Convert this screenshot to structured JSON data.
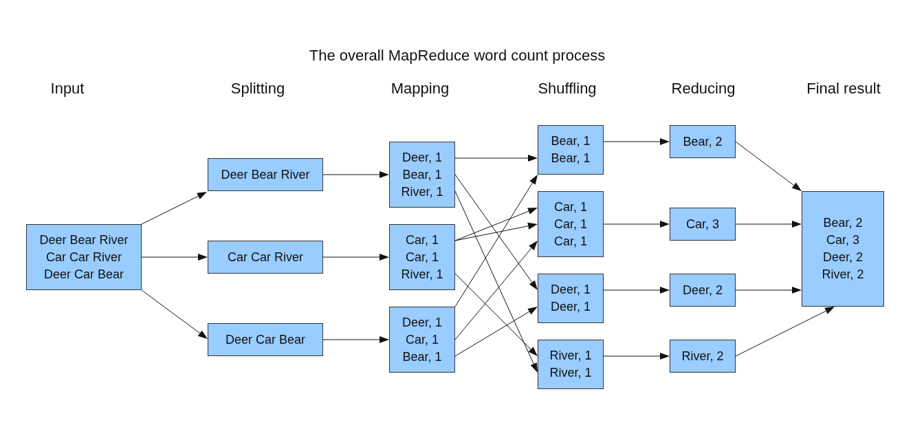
{
  "title": "The overall MapReduce word count process",
  "columns": [
    {
      "heading": "Input",
      "nodes": [
        {
          "lines": [
            "Deer Bear River",
            "Car Car River",
            "Deer Car Bear"
          ]
        }
      ]
    },
    {
      "heading": "Splitting",
      "nodes": [
        {
          "lines": [
            "Deer Bear River"
          ]
        },
        {
          "lines": [
            "Car Car River"
          ]
        },
        {
          "lines": [
            "Deer Car Bear"
          ]
        }
      ]
    },
    {
      "heading": "Mapping",
      "nodes": [
        {
          "lines": [
            "Deer, 1",
            "Bear, 1",
            "River, 1"
          ]
        },
        {
          "lines": [
            "Car, 1",
            "Car, 1",
            "River, 1"
          ]
        },
        {
          "lines": [
            "Deer, 1",
            "Car, 1",
            "Bear, 1"
          ]
        }
      ]
    },
    {
      "heading": "Shuffling",
      "nodes": [
        {
          "lines": [
            "Bear, 1",
            "Bear, 1"
          ]
        },
        {
          "lines": [
            "Car, 1",
            "Car, 1",
            "Car, 1"
          ]
        },
        {
          "lines": [
            "Deer, 1",
            "Deer, 1"
          ]
        },
        {
          "lines": [
            "River, 1",
            "River, 1"
          ]
        }
      ]
    },
    {
      "heading": "Reducing",
      "nodes": [
        {
          "lines": [
            "Bear, 2"
          ]
        },
        {
          "lines": [
            "Car, 3"
          ]
        },
        {
          "lines": [
            "Deer, 2"
          ]
        },
        {
          "lines": [
            "River, 2"
          ]
        }
      ]
    },
    {
      "heading": "Final result",
      "nodes": [
        {
          "lines": [
            "Bear, 2",
            "Car, 3",
            "Deer, 2",
            "River, 2"
          ]
        }
      ]
    }
  ]
}
